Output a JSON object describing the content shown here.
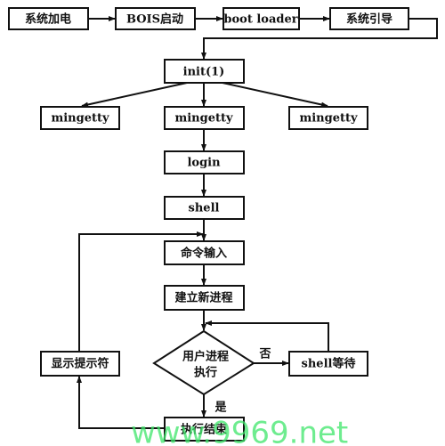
{
  "nodes": {
    "power_on": "系统加电",
    "bios": "BOIS启动",
    "boot_loader": "boot loader",
    "sys_boot": "系统引导",
    "init": "init(1)",
    "mingetty_left": "mingetty",
    "mingetty_mid": "mingetty",
    "mingetty_right": "mingetty",
    "login": "login",
    "shell": "shell",
    "cmd_input": "命令输入",
    "new_process": "建立新进程",
    "decision_line1": "用户进程",
    "decision_line2": "执行",
    "shell_wait": "shell等待",
    "show_prompt": "显示提示符",
    "exec_end": "执行结束"
  },
  "labels": {
    "no": "否",
    "yes": "是"
  },
  "watermark": "www.9969.net",
  "colors": {
    "line": "#111111",
    "watermark": "#3ee66a"
  }
}
